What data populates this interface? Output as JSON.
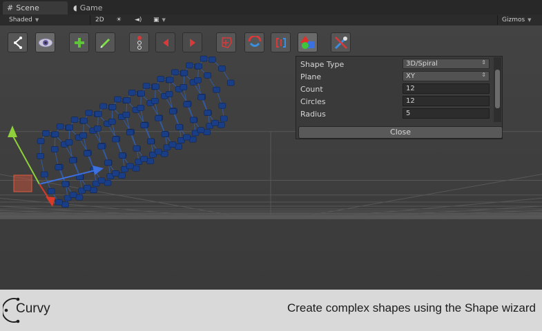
{
  "tabs": [
    {
      "label": "Scene",
      "icon": "grid-icon",
      "active": true
    },
    {
      "label": "Game",
      "icon": "pacman-icon",
      "active": false
    }
  ],
  "scene_toolbar": {
    "shading_mode": "Shaded",
    "mode_2d": "2D",
    "gizmos": "Gizmos"
  },
  "curvy_toolbar": [
    {
      "icon": "curvy-logo-icon"
    },
    {
      "icon": "eye-icon"
    },
    {
      "icon": "add-icon"
    },
    {
      "icon": "draw-icon"
    },
    {
      "icon": "insert-point-icon"
    },
    {
      "icon": "arrow-left-icon"
    },
    {
      "icon": "arrow-right-icon"
    },
    {
      "icon": "shape-select-icon"
    },
    {
      "icon": "magnet-icon"
    },
    {
      "icon": "bracket-icon"
    },
    {
      "icon": "shape-wizard-icon"
    },
    {
      "icon": "tools-icon"
    }
  ],
  "shape_wizard": {
    "fields": [
      {
        "label": "Shape Type",
        "value": "3D/Spiral",
        "type": "dropdown"
      },
      {
        "label": "Plane",
        "value": "XY",
        "type": "dropdown"
      },
      {
        "label": "Count",
        "value": "12",
        "type": "number"
      },
      {
        "label": "Circles",
        "value": "12",
        "type": "number"
      },
      {
        "label": "Radius",
        "value": "5",
        "type": "number"
      }
    ],
    "close_label": "Close"
  },
  "gizmo_colors": {
    "x": "#d93a2a",
    "y": "#8fd13a",
    "z": "#3c6fe0"
  },
  "spline_color": "#2f5fb8",
  "control_point_color": "#1a3e86",
  "footer": {
    "brand": "Curvy",
    "caption": "Create complex shapes using the Shape wizard"
  }
}
